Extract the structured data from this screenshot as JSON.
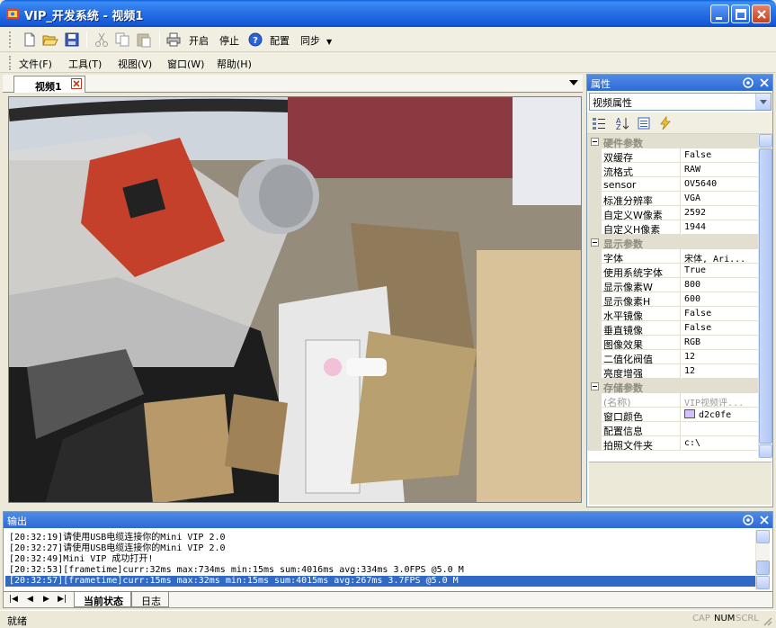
{
  "window": {
    "title": "VIP_开发系统 - 视频1"
  },
  "toolbar": {
    "icons": [
      "new-file-icon",
      "open-folder-icon",
      "save-icon",
      "cut-icon",
      "copy-icon",
      "paste-icon",
      "print-icon",
      "help-icon"
    ],
    "start_label": "开启",
    "stop_label": "停止",
    "config_label": "配置",
    "sync_label": "同步"
  },
  "menu": {
    "items": [
      "文件(F)",
      "工具(T)",
      "视图(V)",
      "窗口(W)",
      "帮助(H)"
    ]
  },
  "document": {
    "tab_label": "视频1"
  },
  "properties": {
    "title": "属性",
    "selected_object": "视频属性",
    "toolbar_icons": [
      "categorized-icon",
      "alphabetical-icon",
      "property-pages-icon",
      "events-icon"
    ],
    "categories": [
      {
        "name": "硬件参数",
        "rows": [
          {
            "name": "双缓存",
            "value": "False"
          },
          {
            "name": "流格式",
            "value": "RAW"
          },
          {
            "name": "sensor",
            "value": "OV5640"
          },
          {
            "name": "标准分辨率",
            "value": "VGA"
          },
          {
            "name": "自定义W像素",
            "value": "2592"
          },
          {
            "name": "自定义H像素",
            "value": "1944"
          }
        ]
      },
      {
        "name": "显示参数",
        "rows": [
          {
            "name": "字体",
            "value": "宋体, Ari..."
          },
          {
            "name": "使用系统字体",
            "value": "True"
          },
          {
            "name": "显示像素W",
            "value": "800"
          },
          {
            "name": "显示像素H",
            "value": "600"
          },
          {
            "name": "水平镜像",
            "value": "False"
          },
          {
            "name": "垂直镜像",
            "value": "False"
          },
          {
            "name": "图像效果",
            "value": "RGB"
          },
          {
            "name": "二值化阀值",
            "value": "12"
          },
          {
            "name": "亮度增强",
            "value": "12"
          }
        ]
      },
      {
        "name": "存储参数",
        "rows": [
          {
            "name": "(名称)",
            "value": "VIP视频评...",
            "disabled": true
          },
          {
            "name": "窗口颜色",
            "value": "d2c0fe",
            "swatch": "#D2C0FE"
          },
          {
            "name": "配置信息",
            "value": ""
          },
          {
            "name": "拍照文件夹",
            "value": "c:\\"
          }
        ]
      }
    ]
  },
  "output": {
    "title": "输出",
    "lines": [
      "[20:32:19]请使用USB电缆连接你的Mini VIP 2.0",
      "[20:32:27]请使用USB电缆连接你的Mini VIP 2.0",
      "[20:32:49]Mini VIP 成功打开!",
      "[20:32:53][frametime]curr:32ms max:734ms min:15ms sum:4016ms avg:334ms 3.0FPS @5.0 M",
      "[20:32:57][frametime]curr:15ms max:32ms min:15ms sum:4015ms avg:267ms 3.7FPS @5.0 M"
    ],
    "selected_line": 4,
    "tabs": [
      "当前状态",
      "日志"
    ]
  },
  "status": {
    "text": "就绪",
    "indicators": [
      {
        "label": "CAP",
        "on": false
      },
      {
        "label": "NUM",
        "on": true
      },
      {
        "label": "SCRL",
        "on": false
      }
    ]
  }
}
